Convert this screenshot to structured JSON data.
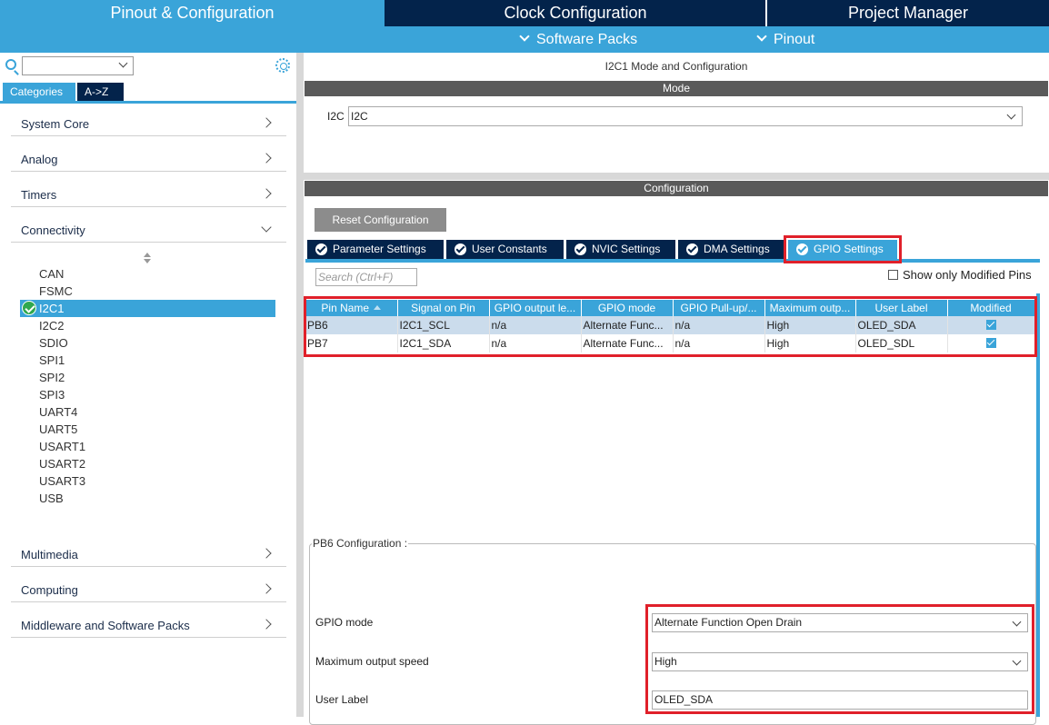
{
  "top_tabs": [
    "Pinout & Configuration",
    "Clock Configuration",
    "Project Manager"
  ],
  "sub_menu": [
    "Software Packs",
    "Pinout"
  ],
  "left": {
    "tabs": [
      "Categories",
      "A->Z"
    ],
    "categories": [
      "System Core",
      "Analog",
      "Timers",
      "Connectivity",
      "Multimedia",
      "Computing",
      "Middleware and Software Packs"
    ],
    "connectivity_items": [
      "CAN",
      "FSMC",
      "I2C1",
      "I2C2",
      "SDIO",
      "SPI1",
      "SPI2",
      "SPI3",
      "UART4",
      "UART5",
      "USART1",
      "USART2",
      "USART3",
      "USB"
    ],
    "selected_item": "I2C1"
  },
  "right": {
    "title": "I2C1 Mode and Configuration",
    "mode_header": "Mode",
    "mode_label": "I2C",
    "mode_value": "I2C",
    "config_header": "Configuration",
    "reset_button": "Reset Configuration",
    "config_tabs": [
      "Parameter Settings",
      "User Constants",
      "NVIC Settings",
      "DMA Settings",
      "GPIO Settings"
    ],
    "active_tab": "GPIO Settings",
    "search_placeholder": "Search (Ctrl+F)",
    "show_modified_label": "Show only Modified Pins",
    "table": {
      "columns": [
        "Pin Name",
        "Signal on Pin",
        "GPIO output le...",
        "GPIO mode",
        "GPIO Pull-up/...",
        "Maximum outp...",
        "User Label",
        "Modified"
      ],
      "rows": [
        [
          "PB6",
          "I2C1_SCL",
          "n/a",
          "Alternate Func...",
          "n/a",
          "High",
          "OLED_SDA",
          true
        ],
        [
          "PB7",
          "I2C1_SDA",
          "n/a",
          "Alternate Func...",
          "n/a",
          "High",
          "OLED_SDL",
          true
        ]
      ]
    },
    "pin_config": {
      "title": "PB6 Configuration :",
      "gpio_mode_label": "GPIO mode",
      "gpio_mode_value": "Alternate Function Open Drain",
      "speed_label": "Maximum output speed",
      "speed_value": "High",
      "user_label_label": "User Label",
      "user_label_value": "OLED_SDA"
    }
  },
  "colors": {
    "navy": "#03234b",
    "accent": "#3aa4d9",
    "highlight_red": "#e0202a",
    "gray_header": "#5a5a5a"
  }
}
